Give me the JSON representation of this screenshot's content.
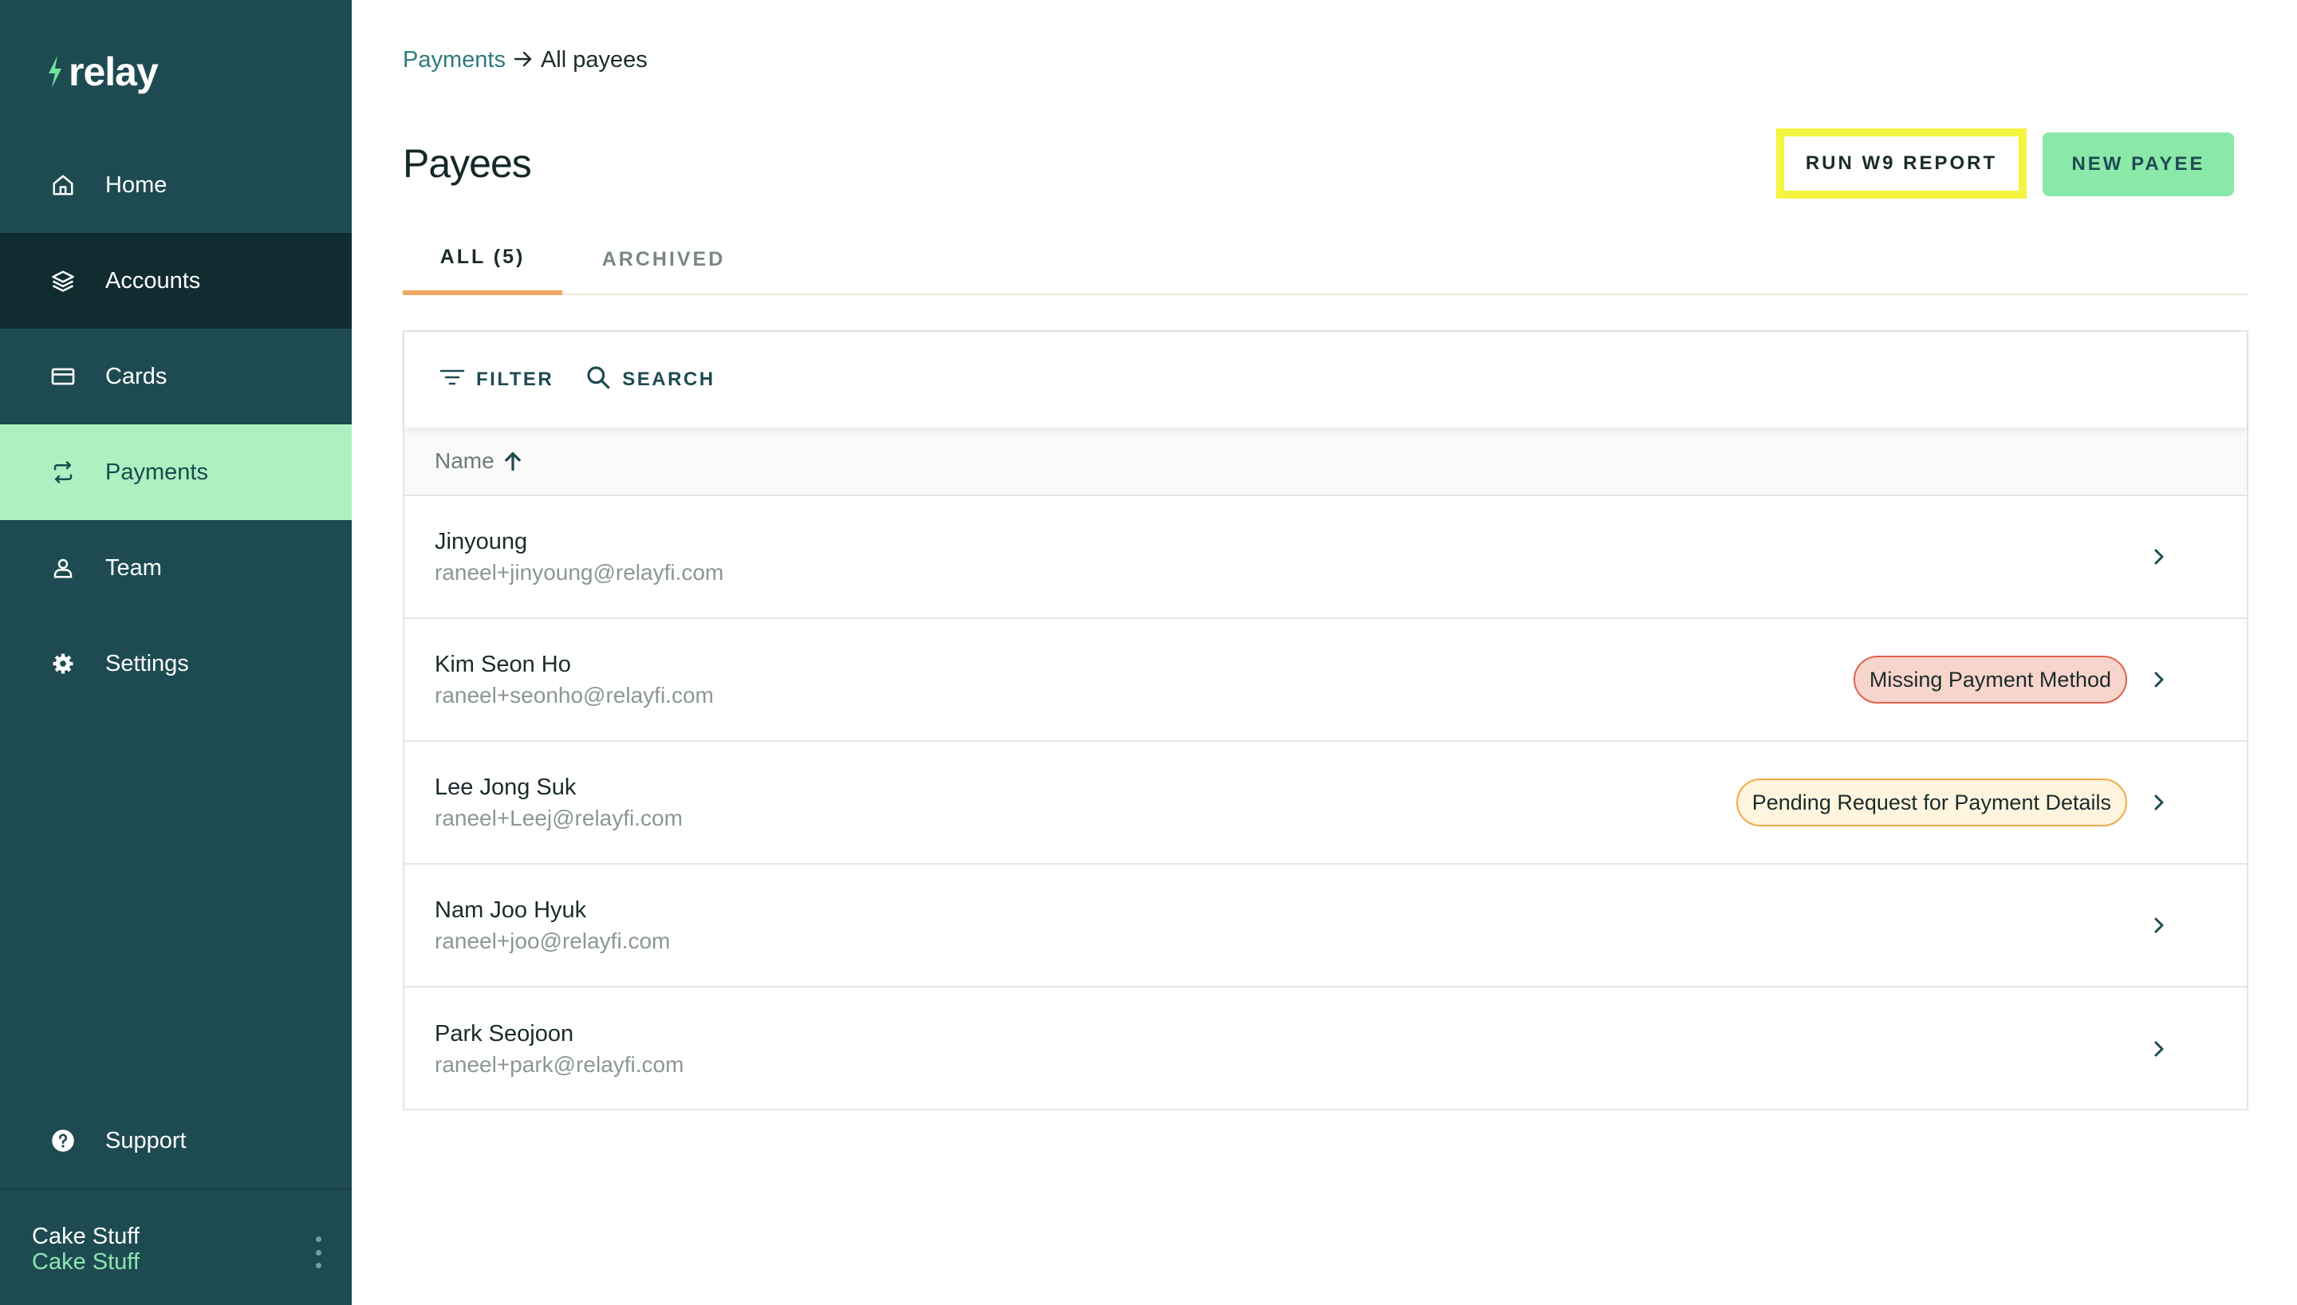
{
  "brand": {
    "name": "relay"
  },
  "sidebar": {
    "items": [
      {
        "label": "Home",
        "icon": "home-icon"
      },
      {
        "label": "Accounts",
        "icon": "layers-icon"
      },
      {
        "label": "Cards",
        "icon": "card-icon"
      },
      {
        "label": "Payments",
        "icon": "transfer-icon"
      },
      {
        "label": "Team",
        "icon": "user-icon"
      },
      {
        "label": "Settings",
        "icon": "gear-icon"
      }
    ],
    "support_label": "Support",
    "account": {
      "name": "Cake Stuff",
      "sub": "Cake Stuff"
    }
  },
  "breadcrumb": {
    "parent": "Payments",
    "current": "All payees"
  },
  "page": {
    "title": "Payees"
  },
  "actions": {
    "run_w9": "RUN W9 REPORT",
    "new_payee": "NEW PAYEE"
  },
  "tabs": {
    "all": "ALL (5)",
    "archived": "ARCHIVED"
  },
  "toolbar": {
    "filter": "FILTER",
    "search": "SEARCH"
  },
  "table": {
    "column_name": "Name",
    "rows": [
      {
        "name": "Jinyoung",
        "email": "raneel+jinyoung@relayfi.com",
        "badge": ""
      },
      {
        "name": "Kim Seon Ho",
        "email": "raneel+seonho@relayfi.com",
        "badge": "Missing Payment Method"
      },
      {
        "name": "Lee Jong Suk",
        "email": "raneel+Leej@relayfi.com",
        "badge": "Pending Request for Payment Details"
      },
      {
        "name": "Nam Joo Hyuk",
        "email": "raneel+joo@relayfi.com",
        "badge": ""
      },
      {
        "name": "Park Seojoon",
        "email": "raneel+park@relayfi.com",
        "badge": ""
      }
    ]
  },
  "colors": {
    "sidebar_bg": "#1e4b52",
    "sidebar_dark": "#112c30",
    "active_bg": "#aef0c0",
    "brand_green": "#8ae8a9",
    "highlight": "#f4f441",
    "tab_underline": "#f0a764"
  }
}
